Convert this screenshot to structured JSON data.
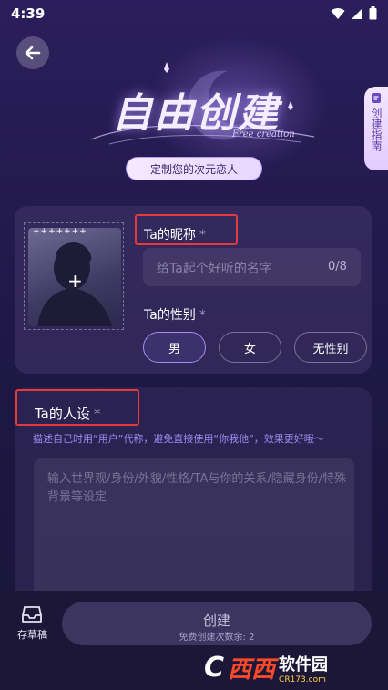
{
  "status_bar": {
    "time": "4:39"
  },
  "header": {
    "title": "自由创建",
    "subtitle": "Free creation",
    "tagline": "定制您的次元恋人",
    "guide_tab": "创建指南"
  },
  "profile": {
    "avatar_dots": "+++++++",
    "avatar_plus": "+",
    "nickname_label": "Ta的昵称",
    "required_mark": "*",
    "nickname_placeholder": "给Ta起个好听的名字",
    "nickname_count": "0/8",
    "gender_label": "Ta的性别",
    "gender_options": [
      "男",
      "女",
      "无性别"
    ],
    "gender_selected": "男"
  },
  "persona": {
    "label": "Ta的人设",
    "required_mark": "*",
    "hint": "描述自己时用“用户”代称，避免直接使用“你我他”，效果更好哦～",
    "placeholder": "输入世界观/身份/外貌/性格/TA与你的关系/隐藏身份/特殊背景等设定"
  },
  "bottom": {
    "draft_label": "存草稿",
    "create_label": "创建",
    "create_sub": "免费创建次数余: 2"
  },
  "watermark": {
    "logo_letter": "C",
    "logo_red": "西西",
    "name": "软件园",
    "url": "CR173.com"
  },
  "colors": {
    "accent": "#a48cf2",
    "highlight_box": "#e53a3a",
    "hint_text": "#9b8cf0"
  }
}
